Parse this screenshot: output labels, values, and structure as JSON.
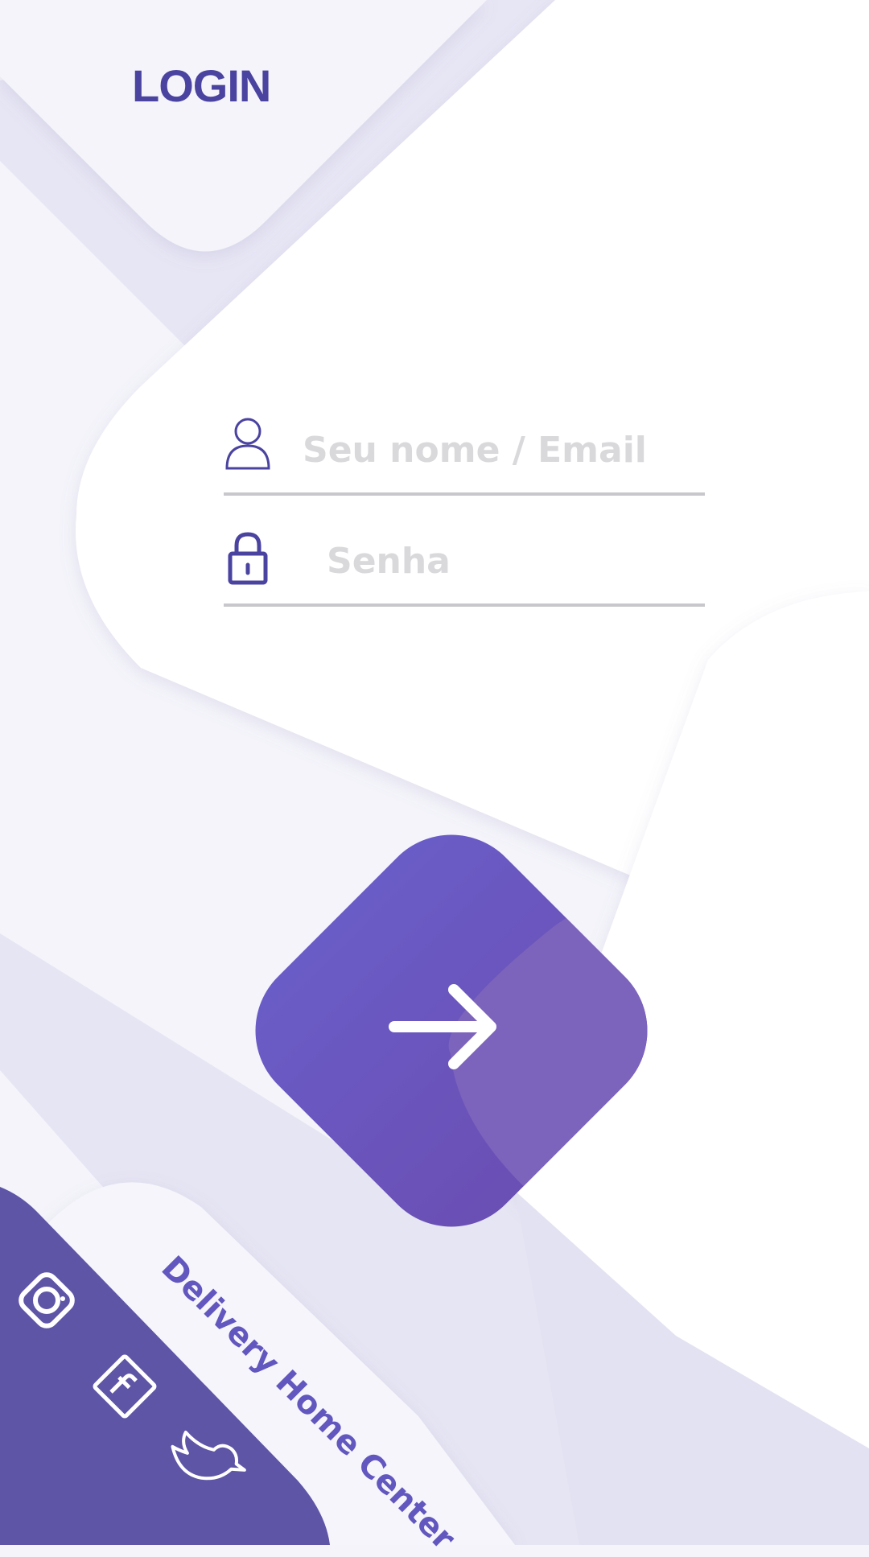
{
  "header": {
    "title": "LOGIN"
  },
  "form": {
    "username_placeholder": "Seu nome / Email",
    "password_placeholder": "Senha"
  },
  "footer": {
    "brand": "Delivery Home Center"
  },
  "colors": {
    "primary": "#4a43a0",
    "button": "#6a5cc6",
    "button_highlight": "#7c63bc",
    "footer_panel": "#5e55a6",
    "field_underline": "#c8c8cc",
    "placeholder": "#d9d9dc"
  },
  "icons": {
    "username": "user-icon",
    "password": "lock-icon",
    "submit": "arrow-right-icon",
    "social": [
      "instagram-icon",
      "facebook-icon",
      "twitter-icon"
    ]
  }
}
